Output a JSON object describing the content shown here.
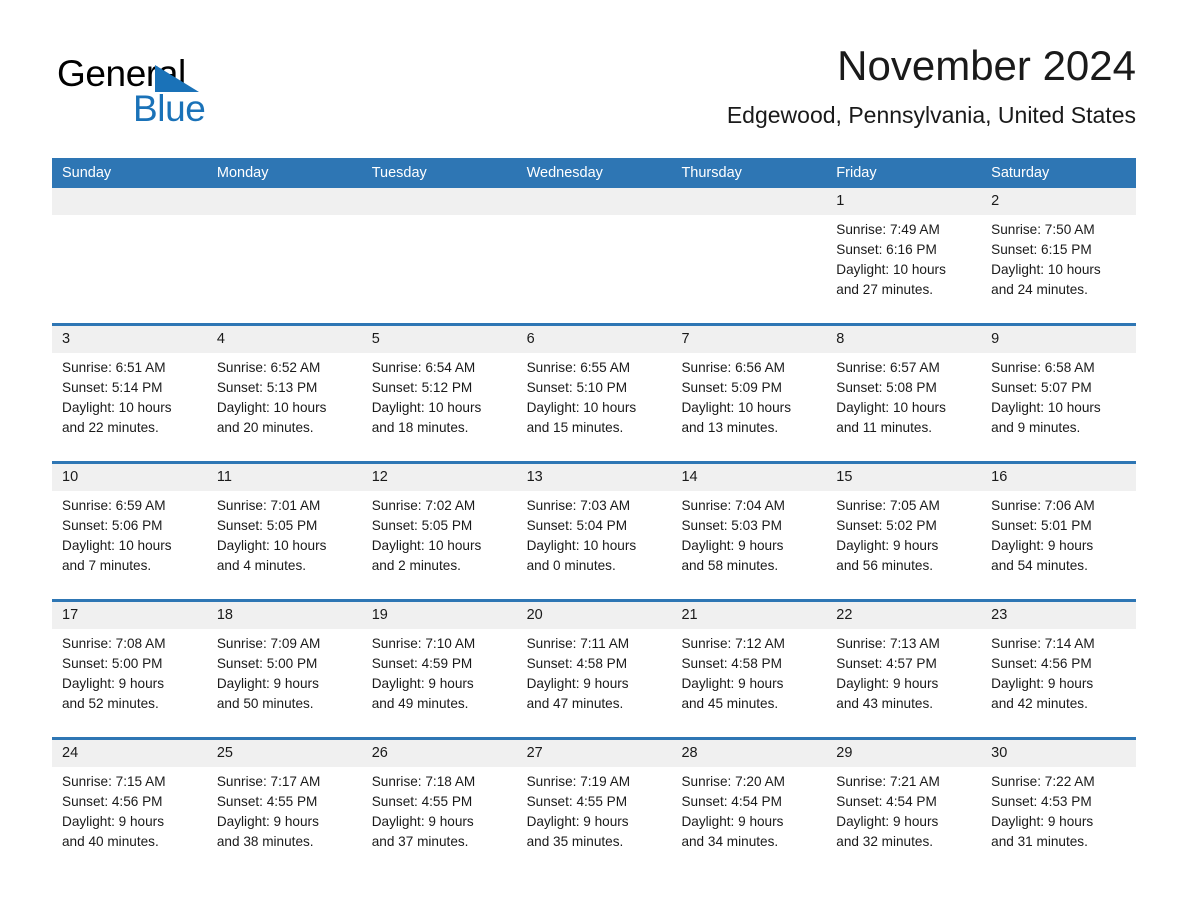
{
  "brand": {
    "name_part1": "General",
    "name_part2": "Blue",
    "accent_color": "#1a72b8",
    "logo_icon": "triangle-flag-icon"
  },
  "header": {
    "month_title": "November 2024",
    "location": "Edgewood, Pennsylvania, United States"
  },
  "calendar": {
    "header_color": "#2e76b4",
    "daynum_band_color": "#f0f0f0",
    "weekdays": [
      "Sunday",
      "Monday",
      "Tuesday",
      "Wednesday",
      "Thursday",
      "Friday",
      "Saturday"
    ],
    "weeks": [
      [
        {
          "day": "",
          "lines": []
        },
        {
          "day": "",
          "lines": []
        },
        {
          "day": "",
          "lines": []
        },
        {
          "day": "",
          "lines": []
        },
        {
          "day": "",
          "lines": []
        },
        {
          "day": "1",
          "lines": [
            "Sunrise: 7:49 AM",
            "Sunset: 6:16 PM",
            "Daylight: 10 hours",
            "and 27 minutes."
          ]
        },
        {
          "day": "2",
          "lines": [
            "Sunrise: 7:50 AM",
            "Sunset: 6:15 PM",
            "Daylight: 10 hours",
            "and 24 minutes."
          ]
        }
      ],
      [
        {
          "day": "3",
          "lines": [
            "Sunrise: 6:51 AM",
            "Sunset: 5:14 PM",
            "Daylight: 10 hours",
            "and 22 minutes."
          ]
        },
        {
          "day": "4",
          "lines": [
            "Sunrise: 6:52 AM",
            "Sunset: 5:13 PM",
            "Daylight: 10 hours",
            "and 20 minutes."
          ]
        },
        {
          "day": "5",
          "lines": [
            "Sunrise: 6:54 AM",
            "Sunset: 5:12 PM",
            "Daylight: 10 hours",
            "and 18 minutes."
          ]
        },
        {
          "day": "6",
          "lines": [
            "Sunrise: 6:55 AM",
            "Sunset: 5:10 PM",
            "Daylight: 10 hours",
            "and 15 minutes."
          ]
        },
        {
          "day": "7",
          "lines": [
            "Sunrise: 6:56 AM",
            "Sunset: 5:09 PM",
            "Daylight: 10 hours",
            "and 13 minutes."
          ]
        },
        {
          "day": "8",
          "lines": [
            "Sunrise: 6:57 AM",
            "Sunset: 5:08 PM",
            "Daylight: 10 hours",
            "and 11 minutes."
          ]
        },
        {
          "day": "9",
          "lines": [
            "Sunrise: 6:58 AM",
            "Sunset: 5:07 PM",
            "Daylight: 10 hours",
            "and 9 minutes."
          ]
        }
      ],
      [
        {
          "day": "10",
          "lines": [
            "Sunrise: 6:59 AM",
            "Sunset: 5:06 PM",
            "Daylight: 10 hours",
            "and 7 minutes."
          ]
        },
        {
          "day": "11",
          "lines": [
            "Sunrise: 7:01 AM",
            "Sunset: 5:05 PM",
            "Daylight: 10 hours",
            "and 4 minutes."
          ]
        },
        {
          "day": "12",
          "lines": [
            "Sunrise: 7:02 AM",
            "Sunset: 5:05 PM",
            "Daylight: 10 hours",
            "and 2 minutes."
          ]
        },
        {
          "day": "13",
          "lines": [
            "Sunrise: 7:03 AM",
            "Sunset: 5:04 PM",
            "Daylight: 10 hours",
            "and 0 minutes."
          ]
        },
        {
          "day": "14",
          "lines": [
            "Sunrise: 7:04 AM",
            "Sunset: 5:03 PM",
            "Daylight: 9 hours",
            "and 58 minutes."
          ]
        },
        {
          "day": "15",
          "lines": [
            "Sunrise: 7:05 AM",
            "Sunset: 5:02 PM",
            "Daylight: 9 hours",
            "and 56 minutes."
          ]
        },
        {
          "day": "16",
          "lines": [
            "Sunrise: 7:06 AM",
            "Sunset: 5:01 PM",
            "Daylight: 9 hours",
            "and 54 minutes."
          ]
        }
      ],
      [
        {
          "day": "17",
          "lines": [
            "Sunrise: 7:08 AM",
            "Sunset: 5:00 PM",
            "Daylight: 9 hours",
            "and 52 minutes."
          ]
        },
        {
          "day": "18",
          "lines": [
            "Sunrise: 7:09 AM",
            "Sunset: 5:00 PM",
            "Daylight: 9 hours",
            "and 50 minutes."
          ]
        },
        {
          "day": "19",
          "lines": [
            "Sunrise: 7:10 AM",
            "Sunset: 4:59 PM",
            "Daylight: 9 hours",
            "and 49 minutes."
          ]
        },
        {
          "day": "20",
          "lines": [
            "Sunrise: 7:11 AM",
            "Sunset: 4:58 PM",
            "Daylight: 9 hours",
            "and 47 minutes."
          ]
        },
        {
          "day": "21",
          "lines": [
            "Sunrise: 7:12 AM",
            "Sunset: 4:58 PM",
            "Daylight: 9 hours",
            "and 45 minutes."
          ]
        },
        {
          "day": "22",
          "lines": [
            "Sunrise: 7:13 AM",
            "Sunset: 4:57 PM",
            "Daylight: 9 hours",
            "and 43 minutes."
          ]
        },
        {
          "day": "23",
          "lines": [
            "Sunrise: 7:14 AM",
            "Sunset: 4:56 PM",
            "Daylight: 9 hours",
            "and 42 minutes."
          ]
        }
      ],
      [
        {
          "day": "24",
          "lines": [
            "Sunrise: 7:15 AM",
            "Sunset: 4:56 PM",
            "Daylight: 9 hours",
            "and 40 minutes."
          ]
        },
        {
          "day": "25",
          "lines": [
            "Sunrise: 7:17 AM",
            "Sunset: 4:55 PM",
            "Daylight: 9 hours",
            "and 38 minutes."
          ]
        },
        {
          "day": "26",
          "lines": [
            "Sunrise: 7:18 AM",
            "Sunset: 4:55 PM",
            "Daylight: 9 hours",
            "and 37 minutes."
          ]
        },
        {
          "day": "27",
          "lines": [
            "Sunrise: 7:19 AM",
            "Sunset: 4:55 PM",
            "Daylight: 9 hours",
            "and 35 minutes."
          ]
        },
        {
          "day": "28",
          "lines": [
            "Sunrise: 7:20 AM",
            "Sunset: 4:54 PM",
            "Daylight: 9 hours",
            "and 34 minutes."
          ]
        },
        {
          "day": "29",
          "lines": [
            "Sunrise: 7:21 AM",
            "Sunset: 4:54 PM",
            "Daylight: 9 hours",
            "and 32 minutes."
          ]
        },
        {
          "day": "30",
          "lines": [
            "Sunrise: 7:22 AM",
            "Sunset: 4:53 PM",
            "Daylight: 9 hours",
            "and 31 minutes."
          ]
        }
      ]
    ]
  }
}
